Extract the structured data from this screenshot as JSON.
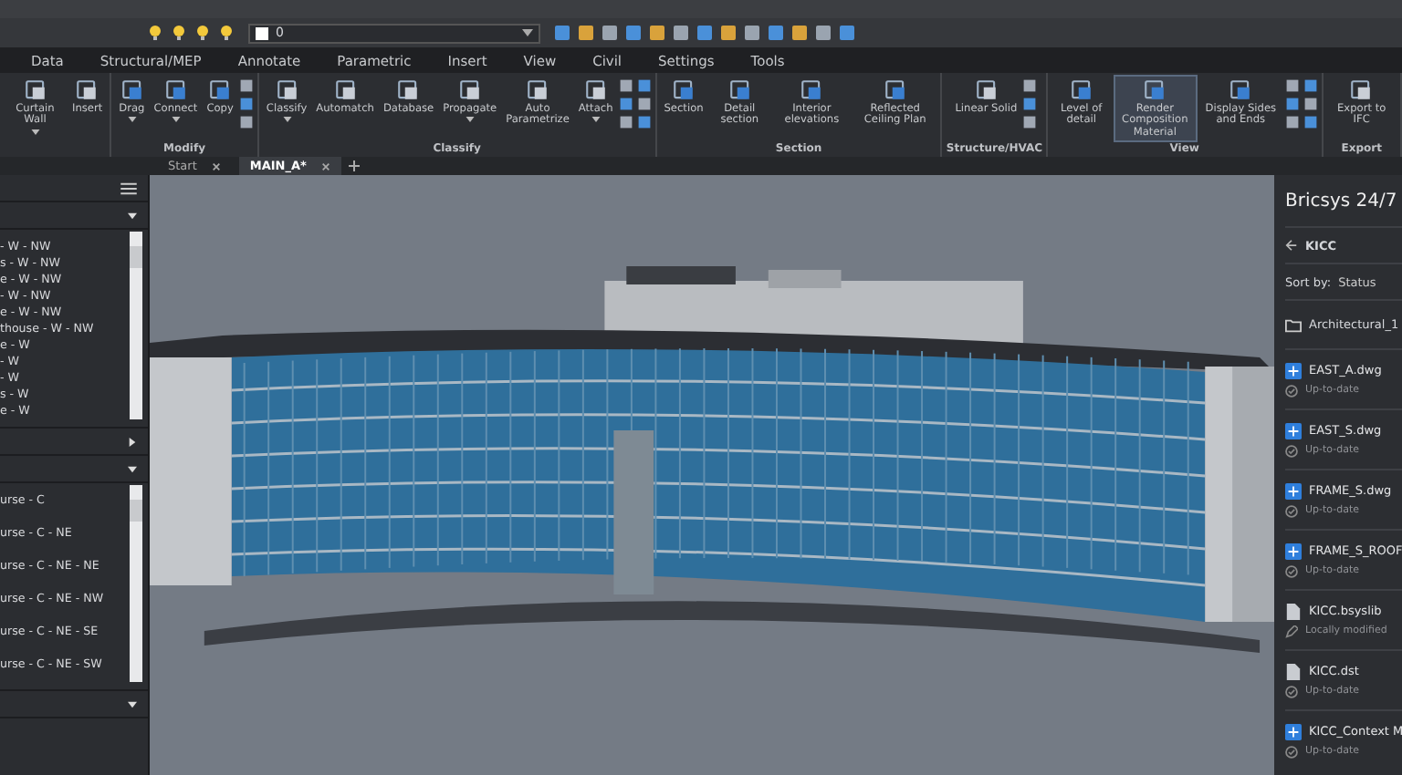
{
  "quick_access": {
    "layer_value": "0"
  },
  "ribbon_tabs": [
    {
      "label": "Data",
      "selected": false
    },
    {
      "label": "Structural/MEP",
      "selected": false
    },
    {
      "label": "Annotate",
      "selected": false
    },
    {
      "label": "Parametric",
      "selected": false
    },
    {
      "label": "Insert",
      "selected": false
    },
    {
      "label": "View",
      "selected": false
    },
    {
      "label": "Civil",
      "selected": false
    },
    {
      "label": "Settings",
      "selected": false
    },
    {
      "label": "Tools",
      "selected": false
    }
  ],
  "ribbon_groups": [
    {
      "buttons": [
        {
          "label": "Curtain Wall",
          "has_menu": true,
          "selected": false
        },
        {
          "label": "Insert",
          "has_menu": false,
          "selected": false
        }
      ]
    },
    {
      "title": "Modify",
      "buttons": [
        {
          "label": "Drag",
          "has_menu": true,
          "selected": false
        },
        {
          "label": "Connect",
          "has_menu": true,
          "selected": false
        },
        {
          "label": "Copy",
          "has_menu": false,
          "selected": false
        }
      ]
    },
    {
      "title": "Classify",
      "buttons": [
        {
          "label": "Classify",
          "has_menu": true,
          "selected": false
        },
        {
          "label": "Automatch",
          "has_menu": false,
          "selected": false
        },
        {
          "label": "Database",
          "has_menu": false,
          "selected": false
        },
        {
          "label": "Propagate",
          "has_menu": true,
          "selected": false
        },
        {
          "label": "Auto Parametrize",
          "has_menu": false,
          "selected": false
        },
        {
          "label": "Attach",
          "has_menu": true,
          "selected": false
        }
      ]
    },
    {
      "title": "Section",
      "buttons": [
        {
          "label": "Section",
          "has_menu": false,
          "selected": false
        },
        {
          "label": "Detail section",
          "has_menu": false,
          "selected": false
        },
        {
          "label": "Interior elevations",
          "has_menu": false,
          "selected": false
        },
        {
          "label": "Reflected Ceiling Plan",
          "has_menu": false,
          "selected": false
        }
      ]
    },
    {
      "title": "Structure/HVAC",
      "buttons": [
        {
          "label": "Linear Solid",
          "has_menu": false,
          "selected": false
        }
      ]
    },
    {
      "title": "View",
      "buttons": [
        {
          "label": "Level of detail",
          "has_menu": false,
          "selected": false
        },
        {
          "label": "Render Composition Material",
          "has_menu": false,
          "selected": true
        },
        {
          "label": "Display Sides and Ends",
          "has_menu": false,
          "selected": false
        }
      ]
    },
    {
      "title": "Export",
      "buttons": [
        {
          "label": "Export to IFC",
          "has_menu": false,
          "selected": false
        }
      ]
    }
  ],
  "document_tabs": [
    {
      "label": "Start",
      "selected": false
    },
    {
      "label": "MAIN_A*",
      "selected": true
    }
  ],
  "left_panel": {
    "sections": [
      {
        "expanded": true,
        "items": [
          "- W - NW",
          "s - W - NW",
          "e - W - NW",
          "- W - NW",
          "e - W - NW",
          "thouse - W - NW",
          "e - W",
          "- W",
          "- W",
          "s - W",
          "e - W"
        ]
      },
      {
        "expanded": false
      },
      {
        "expanded": true,
        "items": [
          "urse - C",
          "urse - C - NE",
          "urse - C - NE - NE",
          "urse - C - NE - NW",
          "urse - C - NE - SE",
          "urse - C - NE - SW"
        ]
      },
      {
        "expanded": true
      }
    ]
  },
  "right_panel": {
    "title": "Bricsys 24/7",
    "project": "KICC",
    "sort_label": "Sort by:",
    "sort_value": "Status",
    "folder": "Architectural_1",
    "files": [
      {
        "name": "EAST_A.dwg",
        "kind": "drawing",
        "status": "Up-to-date",
        "modified": false
      },
      {
        "name": "EAST_S.dwg",
        "kind": "drawing",
        "status": "Up-to-date",
        "modified": false
      },
      {
        "name": "FRAME_S.dwg",
        "kind": "drawing",
        "status": "Up-to-date",
        "modified": false
      },
      {
        "name": "FRAME_S_ROOF",
        "kind": "drawing",
        "status": "Up-to-date",
        "modified": false
      },
      {
        "name": "KICC.bsyslib",
        "kind": "document",
        "status": "Locally modified",
        "modified": true
      },
      {
        "name": "KICC.dst",
        "kind": "document",
        "status": "Up-to-date",
        "modified": false
      },
      {
        "name": "KICC_Context M",
        "kind": "drawing",
        "status": "Up-to-date",
        "modified": false
      }
    ]
  }
}
